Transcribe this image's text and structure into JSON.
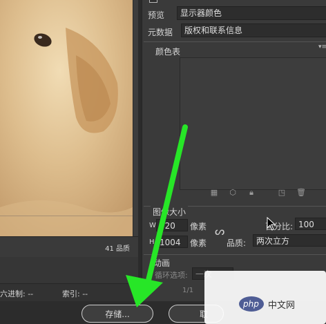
{
  "preview": {
    "quality_readout": "41 品质"
  },
  "status": {
    "hex_label": "六进制: --",
    "index_label": "索引: --"
  },
  "settings": {
    "preview_label": "预览",
    "preview_value": "显示器颜色",
    "metadata_label": "元数据",
    "metadata_value": "版权和联系信息",
    "color_table_title": "颜色表",
    "image_size": {
      "title": "图像大小",
      "width_label": "W:",
      "width_value": "720",
      "height_label": "H:",
      "height_value": "1004",
      "unit": "像素",
      "percent_label": "百分比:",
      "percent_value": "100",
      "quality_label": "品质:",
      "quality_value": "两次立方"
    },
    "animation": {
      "title": "动画",
      "loop_label": "循环选项:",
      "loop_value": "一次",
      "frame_counter": "1/1"
    }
  },
  "buttons": {
    "save_label": "存储...",
    "cancel_label": "取"
  },
  "watermark": {
    "logo_text": "php",
    "site_text": "中文网"
  },
  "colors": {
    "panel_bg": "#3a3a3a",
    "field_bg": "#2d2d2d",
    "arrow": "#27e627"
  }
}
